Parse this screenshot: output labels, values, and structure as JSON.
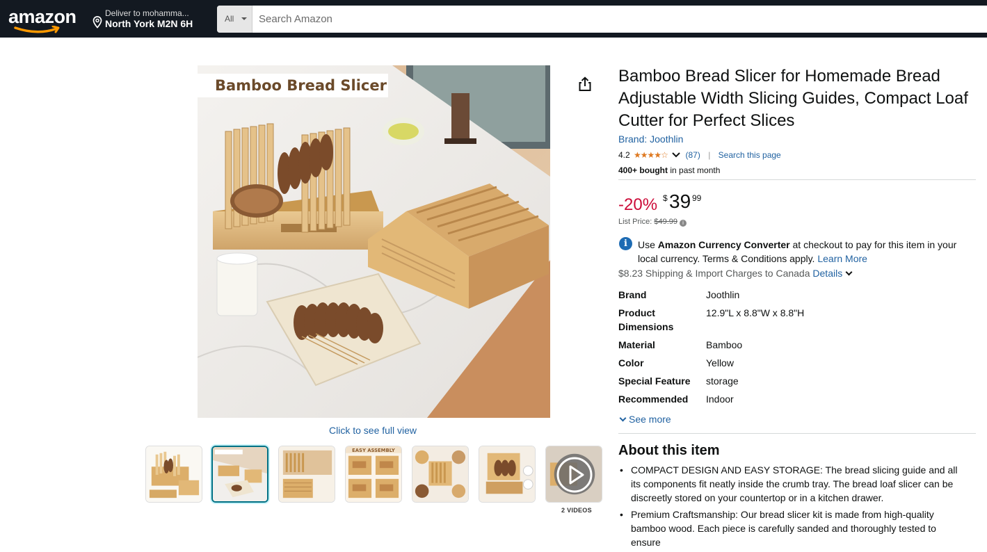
{
  "header": {
    "logo": "amazon",
    "deliver_line1": "Deliver to mohamma...",
    "deliver_line2": "North York M2N 6H",
    "search_category": "All",
    "search_placeholder": "Search Amazon"
  },
  "gallery": {
    "image_label": "Bamboo Bread Slicer",
    "full_view": "Click to see full view",
    "videos_label": "2 VIDEOS",
    "thumbnails": [
      {
        "name": "thumb-1",
        "selected": false
      },
      {
        "name": "thumb-2",
        "selected": true
      },
      {
        "name": "thumb-3",
        "selected": false
      },
      {
        "name": "thumb-4",
        "selected": false,
        "text": "ASSEMBLY"
      },
      {
        "name": "thumb-5",
        "selected": false
      },
      {
        "name": "thumb-6",
        "selected": false
      },
      {
        "name": "thumb-video",
        "selected": false
      }
    ]
  },
  "product": {
    "title": "Bamboo Bread Slicer for Homemade Bread Adjustable Width Slicing Guides, Compact Loaf Cutter for Perfect Slices",
    "brand": "Brand: Joothlin",
    "rating": "4.2",
    "stars": "★★★★☆",
    "ratings_count": "(87)",
    "search_page": "Search this page",
    "bought_bold": "400+ bought",
    "bought_rest": " in past month",
    "discount": "-20%",
    "currency": "$",
    "price_whole": "39",
    "price_fraction": "99",
    "list_price_label": "List Price: ",
    "list_price": "$49.99",
    "currency_note_pre": "Use ",
    "currency_note_bold": "Amazon Currency Converter",
    "currency_note_post": " at checkout to pay for this item in your local currency. Terms & Conditions apply. ",
    "learn_more": "Learn More",
    "shipping": "$8.23 Shipping & Import Charges to Canada ",
    "details": "Details"
  },
  "specs": [
    {
      "key": "Brand",
      "value": "Joothlin"
    },
    {
      "key": "Product Dimensions",
      "value": "12.9\"L x 8.8\"W x 8.8\"H"
    },
    {
      "key": "Material",
      "value": "Bamboo"
    },
    {
      "key": "Color",
      "value": "Yellow"
    },
    {
      "key": "Special Feature",
      "value": "storage"
    },
    {
      "key": "Recommended",
      "value": "Indoor"
    }
  ],
  "see_more": "See more",
  "about": {
    "heading": "About this item",
    "bullets": [
      "COMPACT DESIGN AND EASY STORAGE: The bread slicing guide and all its components fit neatly inside the crumb tray. The bread loaf slicer can be discreetly stored on your countertop or in a kitchen drawer.",
      "Premium Craftsmanship: Our bread slicer kit is made from high-quality bamboo wood. Each piece is carefully sanded and thoroughly tested to ensure"
    ]
  },
  "colors": {
    "header_bg": "#131921",
    "link": "#2162a1",
    "discount": "#cc0c39",
    "star": "#de7921",
    "selected_thumb": "#007185"
  }
}
